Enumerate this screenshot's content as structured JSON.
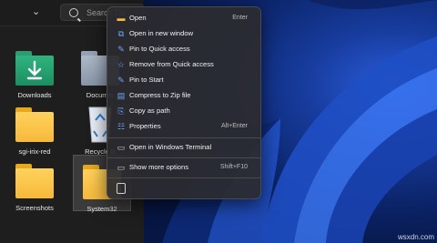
{
  "explorer": {
    "search_placeholder": "Search De",
    "items": [
      {
        "label": "Downloads"
      },
      {
        "label": "Documer"
      },
      {
        "label": "sgi-irix-red"
      },
      {
        "label": "Recycle B"
      },
      {
        "label": "Screenshots"
      },
      {
        "label": "System32"
      }
    ]
  },
  "context_menu": {
    "items": [
      {
        "label": "Open",
        "shortcut": "Enter",
        "icon": "folder-open-icon"
      },
      {
        "label": "Open in new window",
        "shortcut": "",
        "icon": "new-window-icon"
      },
      {
        "label": "Pin to Quick access",
        "shortcut": "",
        "icon": "pin-icon"
      },
      {
        "label": "Remove from Quick access",
        "shortcut": "",
        "icon": "star-icon"
      },
      {
        "label": "Pin to Start",
        "shortcut": "",
        "icon": "pin-start-icon"
      },
      {
        "label": "Compress to Zip file",
        "shortcut": "",
        "icon": "zip-icon"
      },
      {
        "label": "Copy as path",
        "shortcut": "",
        "icon": "copy-path-icon"
      },
      {
        "label": "Properties",
        "shortcut": "Alt+Enter",
        "icon": "properties-icon"
      },
      {
        "label": "Open in Windows Terminal",
        "shortcut": "",
        "icon": "terminal-icon"
      },
      {
        "label": "Show more options",
        "shortcut": "Shift+F10",
        "icon": "more-options-icon"
      }
    ]
  },
  "watermark": "wsxdn.com"
}
